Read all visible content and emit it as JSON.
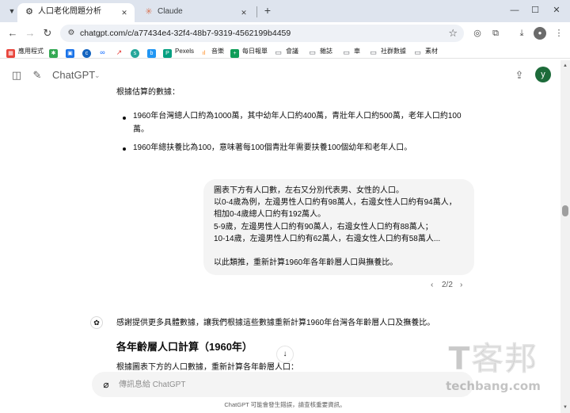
{
  "browser": {
    "tabs": [
      {
        "title": "人口老化問題分析",
        "icon": "openai-icon",
        "active": true
      },
      {
        "title": "Claude",
        "icon": "claude-icon",
        "active": false
      }
    ],
    "new_tab_symbol": "+",
    "window_controls": {
      "minimize": "—",
      "maximize": "☐",
      "close": "✕"
    },
    "url": "chatgpt.com/c/a77434e4-32f4-48b7-9319-4562199b4459"
  },
  "bookmarks": [
    {
      "label": "應用程式",
      "icon": "apps-grid-icon",
      "color": "#e8453c"
    },
    {
      "label": "",
      "icon": "green-leaf-icon",
      "color": "#34a853"
    },
    {
      "label": "",
      "icon": "calendar-icon",
      "color": "#1a73e8"
    },
    {
      "label": "",
      "icon": "c-logo-icon",
      "color": "#1565c0"
    },
    {
      "label": "",
      "icon": "meta-icon",
      "color": "#0866ff"
    },
    {
      "label": "",
      "icon": "trend-icon",
      "color": "#e53935"
    },
    {
      "label": "",
      "icon": "s-logo-icon",
      "color": "#26a69a"
    },
    {
      "label": "",
      "icon": "b-logo-icon",
      "color": "#2196f3"
    },
    {
      "label": "Pexels",
      "icon": "pexels-icon",
      "color": "#05a081"
    },
    {
      "label": "音樂",
      "icon": "audio-icon",
      "color": "#ff7a00"
    },
    {
      "label": "每日報單",
      "icon": "plus-square-icon",
      "color": "#0f9d58"
    },
    {
      "label": "會議",
      "icon": "folder-icon",
      "color": "#5f6368"
    },
    {
      "label": "雜誌",
      "icon": "folder-icon",
      "color": "#5f6368"
    },
    {
      "label": "車",
      "icon": "folder-icon",
      "color": "#5f6368"
    },
    {
      "label": "社群數據",
      "icon": "folder-icon",
      "color": "#5f6368"
    },
    {
      "label": "素材",
      "icon": "folder-icon",
      "color": "#5f6368"
    }
  ],
  "app": {
    "title": "ChatGPT",
    "avatar_letter": "y",
    "avatar_color": "#1d6b3a"
  },
  "conversation": {
    "assistant_intro": "根據估算的數據：",
    "bullets": [
      {
        "lines": [
          "1960年台灣總人口約為1000萬，其中幼年人口約400萬，青壯年人口約500萬，老年人口約100",
          "萬。"
        ]
      },
      {
        "lines": [
          "1960年總扶養比為100，意味著每100個青壯年需要扶養100個幼年和老年人口。"
        ]
      }
    ],
    "user_message_lines": [
      "圖表下方有人口數，左右又分別代表男、女性的人口。",
      "以0-4歲為例，左邊男性人口約有98萬人，右邊女性人口約有94萬人，",
      "相加0-4歲總人口約有192萬人。",
      "5-9歲，左邊男性人口約有90萬人，右邊女性人口約有88萬人；",
      "10-14歲，左邊男性人口約有62萬人，右邊女性人口約有58萬人...",
      "",
      "以此類推，重新計算1960年各年齡層人口與撫養比。"
    ],
    "pager": {
      "prev": "‹",
      "label": "2/2",
      "next": "›"
    },
    "assistant_reply": "感謝提供更多具體數據，讓我們根據這些數據重新計算1960年台灣各年齡層人口及撫養比。",
    "heading": "各年齡層人口計算（1960年）",
    "partial_line": "根據圖表下方的人口數據，重新計算各年齡層人口："
  },
  "composer": {
    "placeholder": "傳訊息給 ChatGPT"
  },
  "disclaimer": "ChatGPT 可能會發生錯誤，請查核重要資訊。",
  "watermark": {
    "big": "T客邦",
    "small": "techbang.com"
  }
}
